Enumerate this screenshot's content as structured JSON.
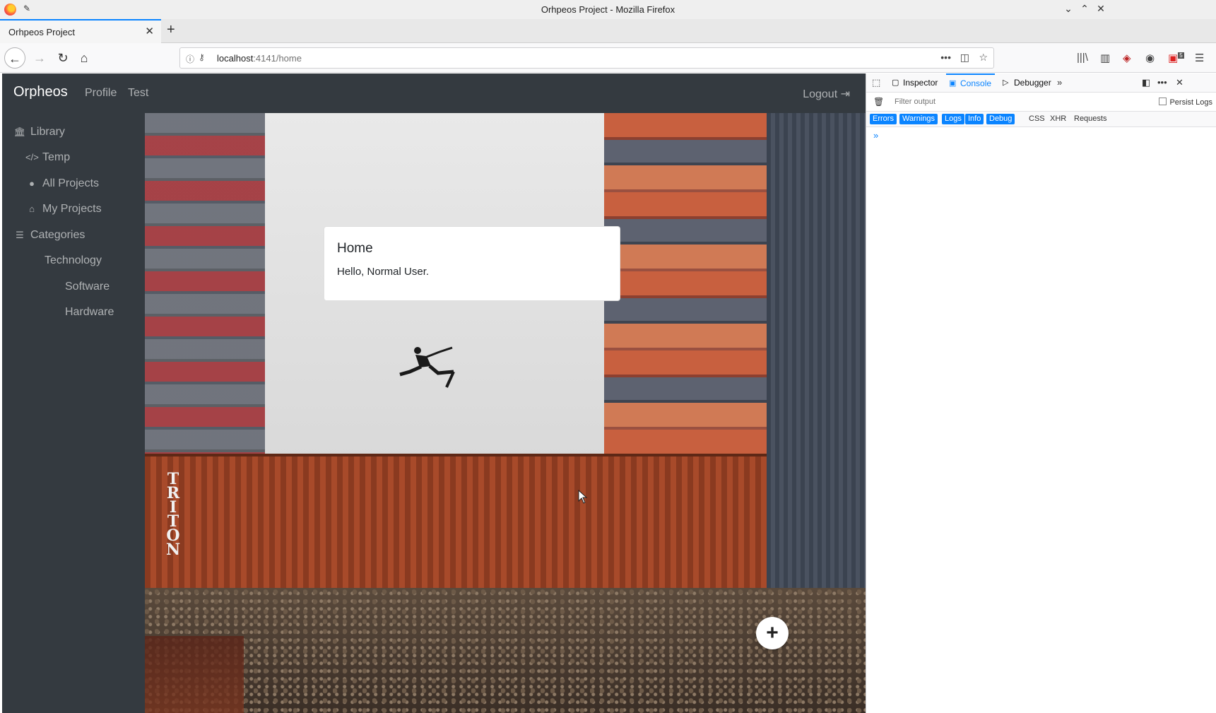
{
  "window": {
    "title": "Orhpeos Project - Mozilla Firefox"
  },
  "tabs": [
    {
      "label": "Orhpeos Project"
    }
  ],
  "address_bar": {
    "host": "localhost",
    "rest": ":4141/home"
  },
  "app": {
    "brand": "Orpheos",
    "nav_links": [
      "Profile",
      "Test"
    ],
    "logout": "Logout"
  },
  "sidebar": {
    "items": [
      {
        "label": "Library",
        "icon": "library-icon",
        "level": 0
      },
      {
        "label": "Temp",
        "icon": "code-icon",
        "level": 1
      },
      {
        "label": "All Projects",
        "icon": "globe-icon",
        "level": 1
      },
      {
        "label": "My Projects",
        "icon": "home-icon",
        "level": 1
      },
      {
        "label": "Categories",
        "icon": "list-icon",
        "level": 0
      },
      {
        "label": "Technology",
        "level": 2
      },
      {
        "label": "Software",
        "level": 3
      },
      {
        "label": "Hardware",
        "level": 3
      }
    ]
  },
  "card": {
    "title": "Home",
    "text": "Hello, Normal User."
  },
  "hero": {
    "container_text": "TRITON"
  },
  "devtools": {
    "tabs": [
      "Inspector",
      "Console",
      "Debugger"
    ],
    "selected_tab": "Console",
    "filter_placeholder": "Filter output",
    "persist_logs": "Persist Logs",
    "levels": [
      "Errors",
      "Warnings",
      "Logs",
      "Info",
      "Debug"
    ],
    "categories": [
      "CSS",
      "XHR",
      "Requests"
    ],
    "prompt": "»"
  },
  "toolbar": {
    "badge_count": "5"
  },
  "colors": {
    "navbar_bg": "#343a40",
    "accent": "#0a84ff"
  }
}
